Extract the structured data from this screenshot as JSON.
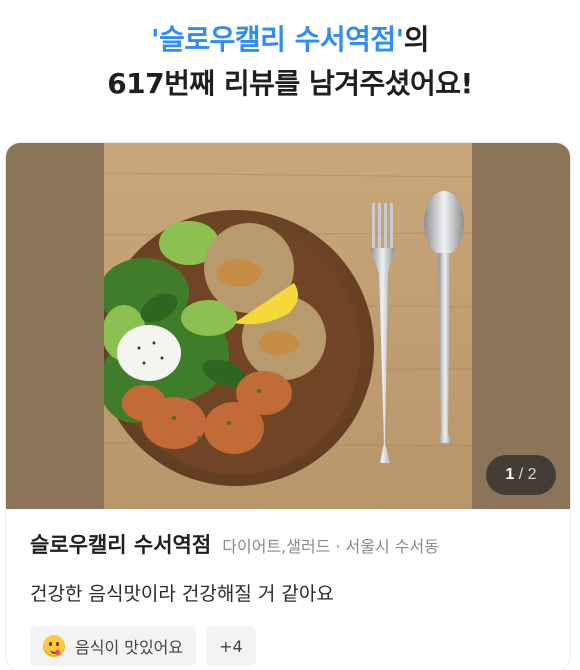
{
  "headline": {
    "line1_accent": "'슬로우캘리 수서역점'",
    "line1_suffix": "의",
    "line2": "617번째 리뷰를 남겨주셨어요!"
  },
  "photo": {
    "counter_current": "1",
    "counter_separator": "/",
    "counter_total": "2"
  },
  "review_card": {
    "store_name": "슬로우캘리 수서역점",
    "category": "다이어트,샐러드",
    "separator": "·",
    "location": "서울시 수서동",
    "review_text": "건강한 음식맛이라 건강해질 거 같아요",
    "tags": [
      {
        "label": "음식이 맛있어요",
        "icon": "yummy-face-emoji-icon"
      },
      {
        "label": "+4"
      }
    ]
  },
  "colors": {
    "accent": "#2f8ef5",
    "photo_background": "#8b7559",
    "tag_background": "#f3f3f3"
  }
}
